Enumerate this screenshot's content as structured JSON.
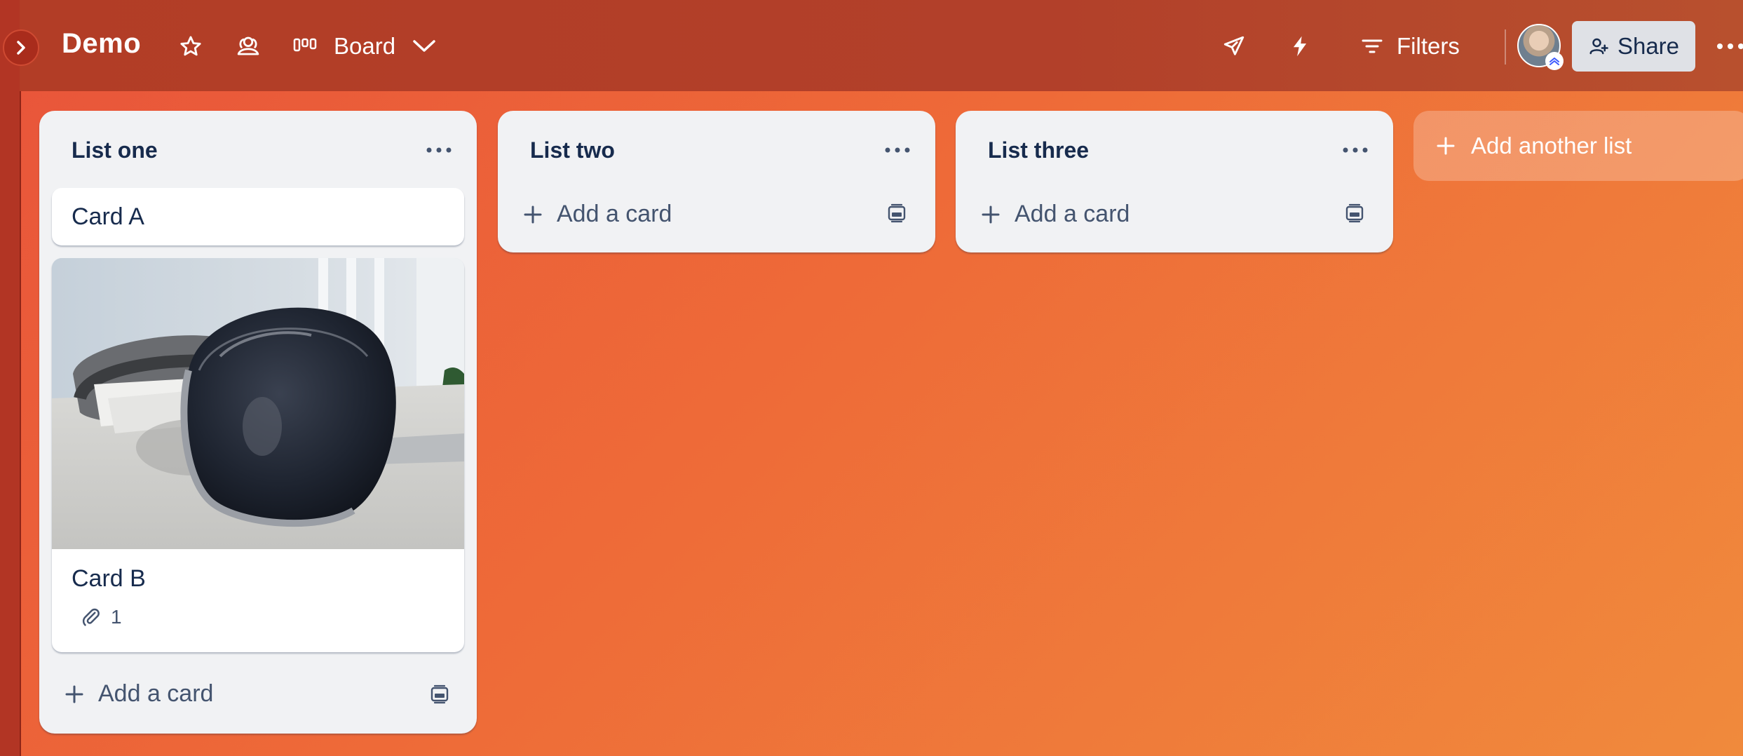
{
  "board": {
    "title": "Demo",
    "view_label": "Board",
    "filters_label": "Filters",
    "share_label": "Share"
  },
  "icons": {
    "sidebar_toggle": "chevron-right-icon",
    "star": "star-icon",
    "visibility": "workspace-visible-icon",
    "view": "board-view-icon",
    "view_dropdown": "chevron-down-icon",
    "power_ups": "rocket-icon",
    "automation": "lightning-icon",
    "filter": "filter-icon",
    "share": "add-member-icon",
    "more": "more-horizontal-icon"
  },
  "lists": [
    {
      "title": "List one",
      "cards": [
        {
          "title": "Card A"
        },
        {
          "title": "Card B",
          "has_cover": true,
          "attachments": "1"
        }
      ],
      "add_card_label": "Add a card"
    },
    {
      "title": "List two",
      "cards": [],
      "add_card_label": "Add a card"
    },
    {
      "title": "List three",
      "cards": [],
      "add_card_label": "Add a card"
    }
  ],
  "add_list_label": "Add another list",
  "colors": {
    "header": "#b2402a",
    "background_start": "#e8543a",
    "background_end": "#f08a3c",
    "list_bg": "#f1f2f4",
    "text_primary": "#172b4d",
    "share_bg": "#dfe1e6"
  }
}
